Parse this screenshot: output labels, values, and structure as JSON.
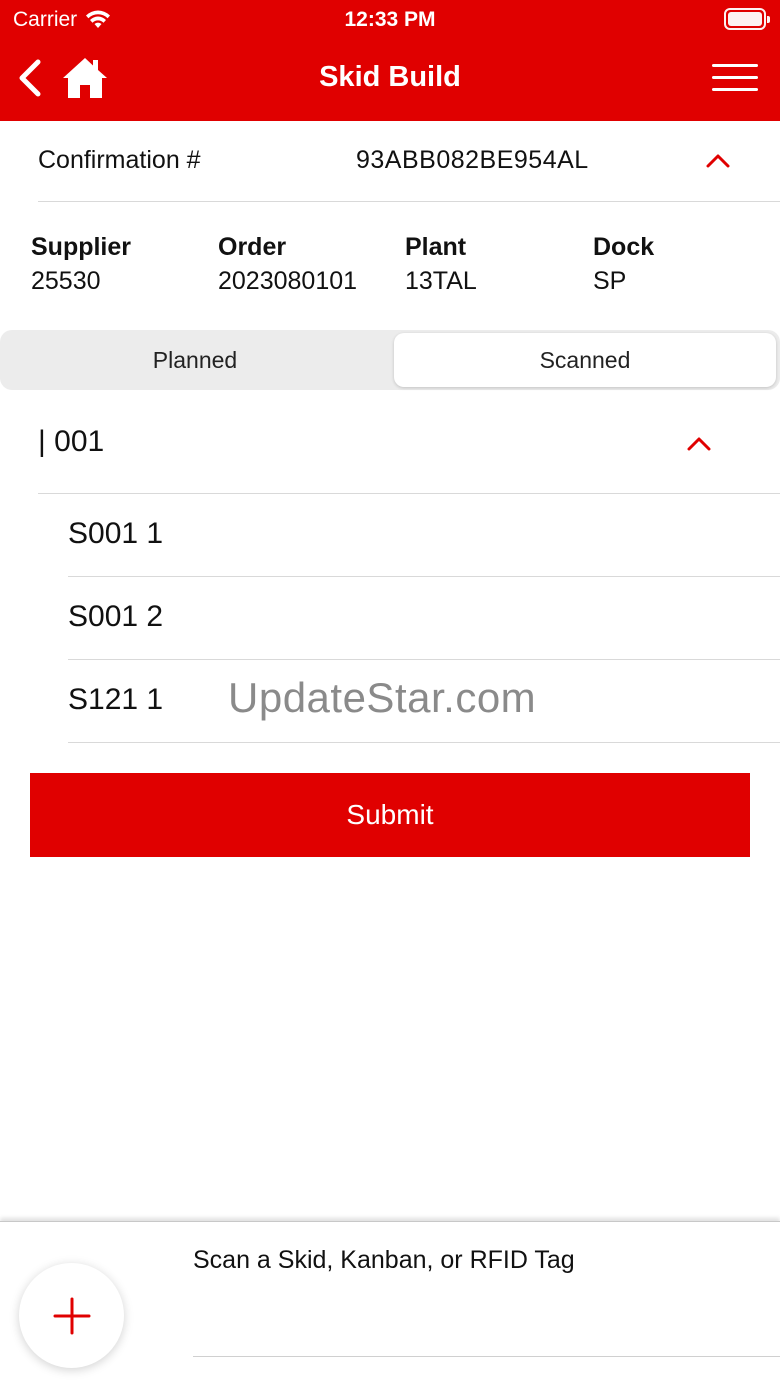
{
  "status_bar": {
    "carrier": "Carrier",
    "time": "12:33 PM"
  },
  "header": {
    "title": "Skid Build"
  },
  "confirmation": {
    "label": "Confirmation #",
    "value": "93ABB082BE954AL"
  },
  "info": {
    "supplier": {
      "label": "Supplier",
      "value": "25530"
    },
    "order": {
      "label": "Order",
      "value": "2023080101"
    },
    "plant": {
      "label": "Plant",
      "value": "13TAL"
    },
    "dock": {
      "label": "Dock",
      "value": "SP"
    }
  },
  "segments": {
    "planned": "Planned",
    "scanned": "Scanned",
    "selected": "Scanned"
  },
  "group": {
    "label": "| 001"
  },
  "rows": [
    "S001 1",
    "S001 2",
    "S121 1"
  ],
  "watermark": "UpdateStar.com",
  "submit_label": "Submit",
  "scan": {
    "label": "Scan a Skid, Kanban, or RFID Tag"
  },
  "colors": {
    "accent": "#e00000"
  }
}
